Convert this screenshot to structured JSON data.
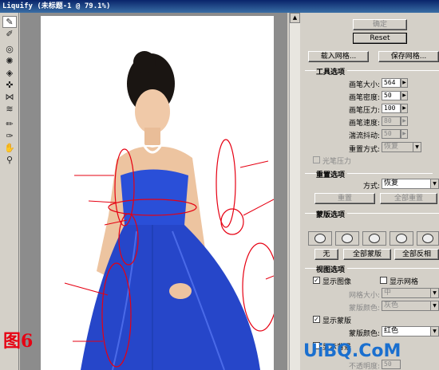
{
  "window": {
    "title": "Liquify (未标题-1 @ 79.1%)"
  },
  "tools": [
    {
      "icon": "forward-warp-icon"
    },
    {
      "icon": "reconstruct-icon"
    },
    {
      "icon": "twirl-icon"
    },
    {
      "icon": "pucker-icon"
    },
    {
      "icon": "bloat-icon"
    },
    {
      "icon": "push-left-icon"
    },
    {
      "icon": "mirror-icon"
    },
    {
      "icon": "turbulence-icon"
    },
    {
      "icon": "freeze-mask-icon"
    },
    {
      "icon": "thaw-mask-icon"
    },
    {
      "icon": "hand-icon"
    },
    {
      "icon": "zoom-icon"
    }
  ],
  "buttons": {
    "ok": "确定",
    "reset": "Reset",
    "load_mesh": "载入网格...",
    "save_mesh": "保存网格...",
    "reconstruct": "重置",
    "restore_all": "全部重置",
    "none": "无",
    "mask_all": "全部蒙版",
    "invert_all": "全部反相"
  },
  "tool_options": {
    "title": "工具选项",
    "brush_size_label": "画笔大小:",
    "brush_size": "564",
    "brush_density_label": "画笔密度:",
    "brush_density": "50",
    "brush_pressure_label": "画笔压力:",
    "brush_pressure": "100",
    "brush_rate_label": "画笔速度:",
    "brush_rate": "80",
    "turbulent_jitter_label": "湍流抖动:",
    "turbulent_jitter": "50",
    "reconstruct_mode_label": "重置方式:",
    "reconstruct_mode": "恢复",
    "stylus_pressure_label": "光笔压力"
  },
  "reconstruct_options": {
    "title": "重置选项",
    "mode_label": "方式:",
    "mode": "恢复"
  },
  "mask_options": {
    "title": "蒙版选项"
  },
  "view_options": {
    "title": "视图选项",
    "show_image_label": "显示图像",
    "show_image": true,
    "show_mesh_label": "显示网格",
    "show_mesh": false,
    "mesh_size_label": "网格大小:",
    "mesh_size": "中",
    "mesh_color_label": "蒙版颜色:",
    "mesh_color": "灰色",
    "show_mask_label": "显示蒙版",
    "show_mask": true,
    "mask_color_label": "蒙版颜色:",
    "mask_color": "红色",
    "show_backdrop_label": "显示背景",
    "opacity_label": "不透明度:",
    "opacity": "50"
  },
  "overlay": {
    "figure_label": "图6",
    "watermark": "UiBQ.CoM"
  },
  "colors": {
    "annotation": "#e60012",
    "dress": "#2a4fd8",
    "title_bar": "#0a246a"
  }
}
